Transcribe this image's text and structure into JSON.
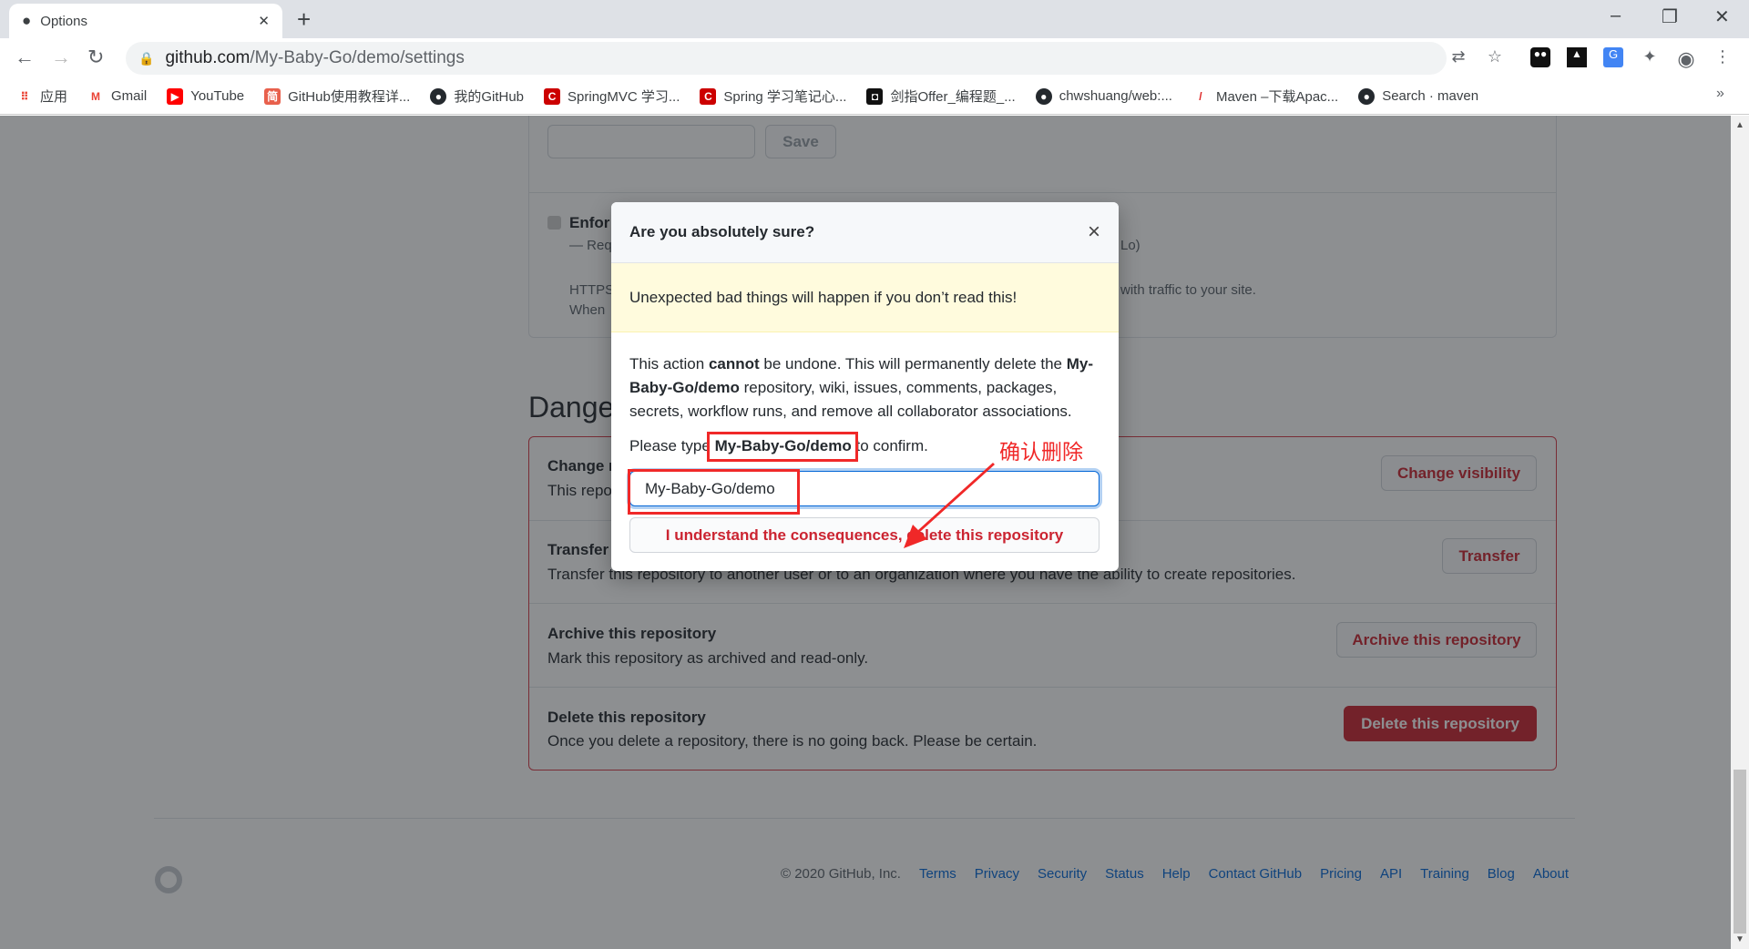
{
  "browser": {
    "tab_title": "Options",
    "new_tab": "+",
    "url_host": "github.com",
    "url_path": "/My-Baby-Go/demo/settings",
    "bookmarks": [
      {
        "label": "应用",
        "icon": "apps-grid-icon"
      },
      {
        "label": "Gmail",
        "icon": "gmail-icon"
      },
      {
        "label": "YouTube",
        "icon": "youtube-icon"
      },
      {
        "label": "GitHub使用教程详...",
        "icon": "jian-icon"
      },
      {
        "label": "我的GitHub",
        "icon": "github-icon"
      },
      {
        "label": "SpringMVC 学习...",
        "icon": "csdn-icon"
      },
      {
        "label": "Spring 学习笔记心...",
        "icon": "csdn-icon"
      },
      {
        "label": "剑指Offer_编程题_...",
        "icon": "nowcoder-icon"
      },
      {
        "label": "chwshuang/web:...",
        "icon": "github-icon"
      },
      {
        "label": "Maven –下载Apac...",
        "icon": "apache-feather-icon"
      },
      {
        "label": "Search · maven",
        "icon": "github-icon"
      }
    ],
    "more_bookmarks": "»"
  },
  "pages_section": {
    "save_label": "Save",
    "enforce_fragment": "Enfor",
    "req_fragment": "— Req",
    "req_tail": "Lo)",
    "https_fragment": "HTTPS",
    "when_fragment": "When",
    "https_tail": "with traffic to your site."
  },
  "danger_zone": {
    "heading": "Dange",
    "rows": [
      {
        "title": "Change r",
        "desc": "This repo",
        "button": "Change visibility"
      },
      {
        "title": "Transfer",
        "desc": "Transfer this repository to another user or to an organization where you have the ability to create repositories.",
        "button": "Transfer"
      },
      {
        "title": "Archive this repository",
        "desc": "Mark this repository as archived and read-only.",
        "button": "Archive this repository"
      },
      {
        "title": "Delete this repository",
        "desc": "Once you delete a repository, there is no going back. Please be certain.",
        "button": "Delete this repository"
      }
    ]
  },
  "footer": {
    "copyright": "© 2020 GitHub, Inc.",
    "links": [
      "Terms",
      "Privacy",
      "Security",
      "Status",
      "Help",
      "Contact GitHub",
      "Pricing",
      "API",
      "Training",
      "Blog",
      "About"
    ]
  },
  "modal": {
    "title": "Are you absolutely sure?",
    "close": "×",
    "warning": "Unexpected bad things will happen if you don’t read this!",
    "p1_a": "This action ",
    "p1_b": "cannot",
    "p1_c": " be undone. This will permanently delete the ",
    "p1_d": "My-Baby-Go/demo",
    "p1_e": " repository, wiki, issues, comments, packages, secrets, workflow runs, and remove all collaborator associations.",
    "p2_a": "Please type ",
    "p2_b": "My-Baby-Go/demo",
    "p2_c": " to confirm.",
    "input_value": "My-Baby-Go/demo",
    "confirm_button": "I understand the consequences, delete this repository"
  },
  "annotation": {
    "label": "确认删除",
    "color": "#f02828"
  }
}
